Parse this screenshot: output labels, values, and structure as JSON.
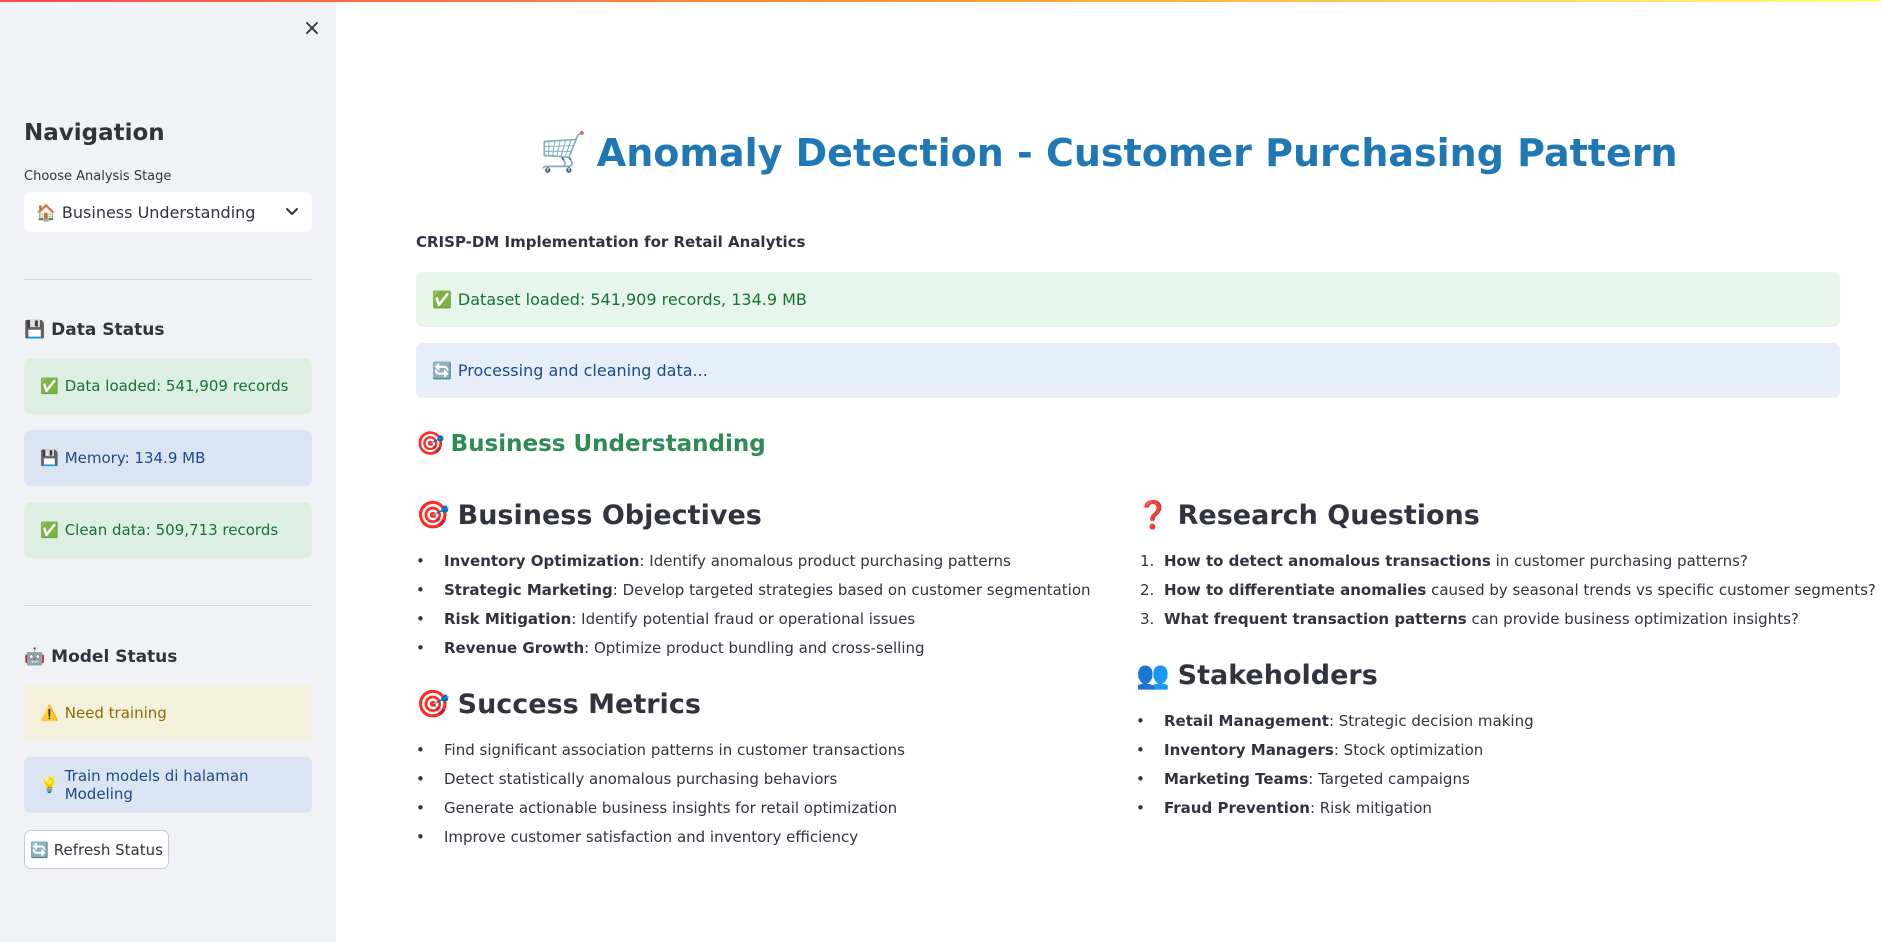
{
  "sidebar": {
    "close_icon": "×",
    "nav_title": "Navigation",
    "select_label": "Choose Analysis Stage",
    "select_icon": "🏠",
    "select_value": "Business Understanding",
    "data_status": {
      "icon": "💾",
      "title": "Data Status"
    },
    "alerts": [
      {
        "icon": "✅",
        "text": "Data loaded: 541,909 records"
      },
      {
        "icon": "💾",
        "text": "Memory: 134.9 MB"
      },
      {
        "icon": "✅",
        "text": "Clean data: 509,713 records"
      }
    ],
    "model_status": {
      "icon": "🤖",
      "title": "Model Status"
    },
    "model_alerts": [
      {
        "icon": "⚠️",
        "text": "Need training"
      },
      {
        "icon": "💡",
        "text": "Train models di halaman Modeling"
      }
    ],
    "refresh_button": {
      "icon": "🔄",
      "label": "Refresh Status"
    }
  },
  "main": {
    "title_icon": "🛒",
    "title": "Anomaly Detection - Customer Purchasing Pattern",
    "subtitle": "CRISP-DM Implementation for Retail Analytics",
    "dataset_alert": {
      "icon": "✅",
      "text": "Dataset loaded: 541,909 records, 134.9 MB"
    },
    "processing_alert": {
      "icon": "🔄",
      "text": "Processing and cleaning data..."
    },
    "section": {
      "icon": "🎯",
      "title": "Business Understanding"
    },
    "objectives": {
      "icon": "🎯",
      "title": "Business Objectives",
      "items": [
        {
          "bold": "Inventory Optimization",
          "text": ": Identify anomalous product purchasing patterns"
        },
        {
          "bold": "Strategic Marketing",
          "text": ": Develop targeted strategies based on customer segmentation"
        },
        {
          "bold": "Risk Mitigation",
          "text": ": Identify potential fraud or operational issues"
        },
        {
          "bold": "Revenue Growth",
          "text": ": Optimize product bundling and cross-selling"
        }
      ]
    },
    "metrics": {
      "icon": "🎯",
      "title": "Success Metrics",
      "items": [
        "Find significant association patterns in customer transactions",
        "Detect statistically anomalous purchasing behaviors",
        "Generate actionable business insights for retail optimization",
        "Improve customer satisfaction and inventory efficiency"
      ]
    },
    "questions": {
      "icon": "❓",
      "title": "Research Questions",
      "items": [
        {
          "num": "1.",
          "bold": "How to detect anomalous transactions",
          "text": " in customer purchasing patterns?"
        },
        {
          "num": "2.",
          "bold": "How to differentiate anomalies",
          "text": " caused by seasonal trends vs specific customer segments?"
        },
        {
          "num": "3.",
          "bold": "What frequent transaction patterns",
          "text": " can provide business optimization insights?"
        }
      ]
    },
    "stakeholders": {
      "icon": "👥",
      "title": "Stakeholders",
      "items": [
        {
          "bold": "Retail Management",
          "text": ": Strategic decision making"
        },
        {
          "bold": "Inventory Managers",
          "text": ": Stock optimization"
        },
        {
          "bold": "Marketing Teams",
          "text": ": Targeted campaigns"
        },
        {
          "bold": "Fraud Prevention",
          "text": ": Risk mitigation"
        }
      ]
    }
  }
}
